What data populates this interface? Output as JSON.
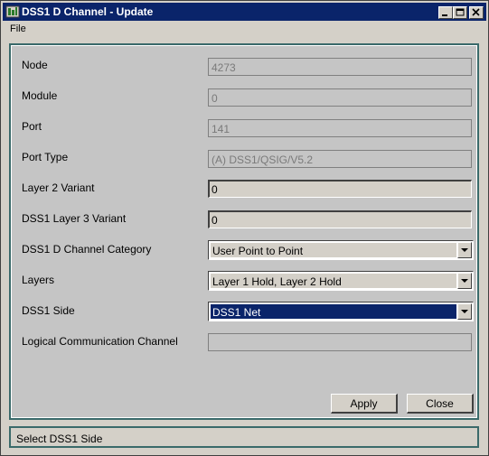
{
  "window": {
    "title": "DSS1 D Channel - Update"
  },
  "menu": {
    "file": "File"
  },
  "form": {
    "fields": [
      {
        "label": "Node",
        "value": "4273"
      },
      {
        "label": "Module",
        "value": "0"
      },
      {
        "label": "Port",
        "value": "141"
      },
      {
        "label": "Port Type",
        "value": "(A) DSS1/QSIG/V5.2"
      },
      {
        "label": "Layer 2 Variant",
        "value": "0"
      },
      {
        "label": "DSS1 Layer 3 Variant",
        "value": "0"
      },
      {
        "label": "DSS1 D Channel Category",
        "value": "User Point to Point"
      },
      {
        "label": "Layers",
        "value": "Layer 1 Hold, Layer 2 Hold"
      },
      {
        "label": "DSS1 Side",
        "value": "DSS1 Net"
      },
      {
        "label": "Logical Communication Channel",
        "value": ""
      }
    ]
  },
  "buttons": {
    "apply": "Apply",
    "close": "Close"
  },
  "status": {
    "text": "Select DSS1 Side"
  },
  "colors": {
    "titlebar": "#0a246a",
    "selection": "#0a246a",
    "frame": "#3a6a6a",
    "face": "#d4d0c8"
  }
}
